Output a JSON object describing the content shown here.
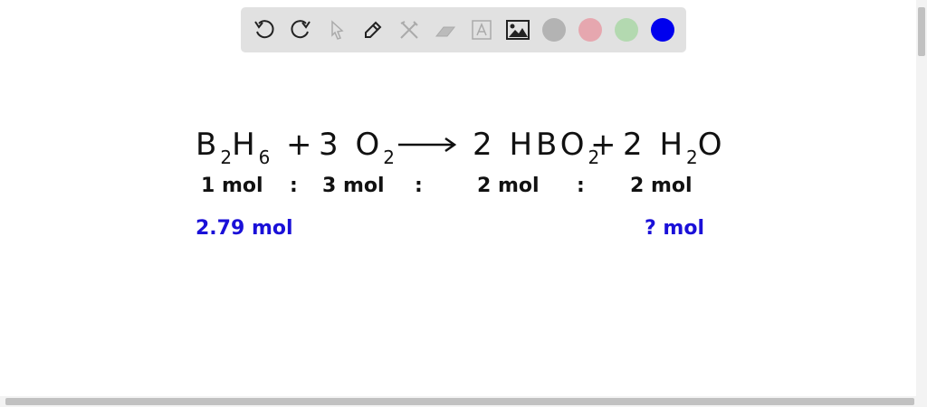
{
  "toolbar": {
    "tools": [
      "undo-icon",
      "redo-icon",
      "select-icon",
      "pen-icon",
      "tools-icon",
      "eraser-icon",
      "text-icon",
      "image-icon"
    ],
    "colors": [
      "#b3b3b3",
      "#e6a7af",
      "#b3d9b0",
      "#0000ee"
    ]
  },
  "equation": {
    "b2h6": "B",
    "b2h6_sub": "2",
    "b2h6_h": "H",
    "b2h6_sub2": "6",
    "plus1": "+",
    "o2_coef": "3",
    "o2": "O",
    "o2_sub": "2",
    "hbo2_coef": "2",
    "hbo2": "HBO",
    "hbo2_sub": "2",
    "plus2": "+",
    "h2o_coef": "2",
    "h2o_h": "H",
    "h2o_sub": "2",
    "h2o_o": "O"
  },
  "ratios": [
    "1 mol",
    ":",
    "3 mol",
    ":",
    "2 mol",
    ":",
    "2 mol"
  ],
  "given": "2.79 mol",
  "unknown": "? mol"
}
